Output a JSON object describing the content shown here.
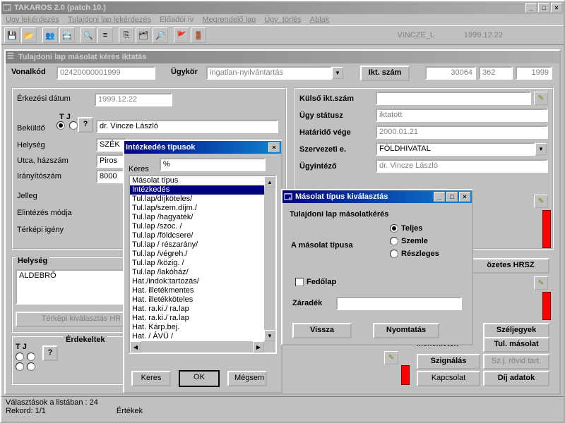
{
  "app": {
    "title": "TAKAROS 2.0 (patch 10.)",
    "user": "VINCZE_L",
    "date": "1999.12.22"
  },
  "menu": {
    "m1": "Ügy lekérdezés",
    "m2": "Tulajdoni lap lekérdezés",
    "m3": "Előadói ív",
    "m4": "Megrendelő lap",
    "m5": "Ügy_törlés",
    "m6": "Ablak"
  },
  "doc": {
    "title": "Tulajdoni lap másolat kérés iktatás",
    "vonalkod_lbl": "Vonalkód",
    "vonalkod": "02420000001999",
    "ugykor_lbl": "Ügykör",
    "ugykor": "ingatlan-nyilvántartás",
    "iktszam_lbl": "Ikt. szám",
    "ikt1": "30064",
    "ikt2": "362",
    "ikt3": "1999"
  },
  "left": {
    "erkezesi_lbl": "Érkezési dátum",
    "erkezesi": "1999.12.22",
    "tj_lbl": "T J",
    "q": "?",
    "bekuldo_lbl": "Beküldő",
    "bekuldo": "dr. Vincze László",
    "helyseg_lbl": "Helység",
    "helyseg": "SZÉK",
    "utca_lbl": "Utca, házszám",
    "utca": "Piros",
    "irsz_lbl": "Irányítószám",
    "irsz": "8000",
    "jelleg_lbl": "Jelleg",
    "elint_lbl": "Elintézés módja",
    "terkep_lbl": "Térképi igény",
    "helyseg2_lbl": "Helység",
    "helyseg2": "ALDEBRŐ",
    "terkepbtn": "Térképi kiválasztás HR",
    "erdekeltek": "Érdekeltek"
  },
  "right": {
    "kulso_lbl": "Külső ikt.szám",
    "status_lbl": "Ügy státusz",
    "status": "iktatott",
    "hatarido_lbl": "Határidő vége",
    "hatarido": "2000.01.21",
    "szerv_lbl": "Szervezeti e.",
    "szerv": "FÖLDHIVATAL",
    "ugyint_lbl": "Ügyintéző",
    "ugyint": "dr. Vincze László",
    "elozetes": "özetes HRSZ",
    "szel": "Széljegyek",
    "mellek": "Mellékletek",
    "tulmas": "Tul. másolat",
    "szign": "Szignálás",
    "szrov": "Sz.j. rövid tart.",
    "kapcs": "Kapcsolat",
    "dij": "Díj adatok"
  },
  "popup1": {
    "title": "Intézkedés típusok",
    "keres_lbl": "Keres",
    "keres": "%",
    "items": [
      "Másolat típus",
      "Intézkedés",
      "Tul.lap/díjköteles/",
      "Tul.lap/szem.díjm./",
      "Tul.lap /hagyaték/",
      "Tul.lap /szoc. /",
      "Tul.lap /földcsere/",
      "Tul.lap / részarány/",
      "Tul.lap /végreh./",
      "Tul.lap /közig. /",
      "Tul.lap /lakóház/",
      "Hat./indok:tartozás/",
      "Hat. illetékmentes",
      "Hat. illetékköteles",
      "Hat. ra.ki./ ra.lap",
      "Hat. ra.ki./ ra.lap",
      "Hat. Kárp.bej.",
      "Hat. / ÁVÜ /"
    ],
    "sel_index": 1,
    "btn_keres": "Keres",
    "btn_ok": "OK",
    "btn_megsem": "Mégsem"
  },
  "popup2": {
    "title": "Másolat  típus kiválasztás",
    "heading": "Tulajdoni lap másolatkérés",
    "tipus_lbl": "A másolat típusa",
    "r_teljes": "Teljes",
    "r_szemle": "Szemle",
    "r_reszl": "Részleges",
    "fedolap": "Fedőlap",
    "zaradek_lbl": "Záradék",
    "btn_vissza": "Vissza",
    "btn_nyomt": "Nyomtatás"
  },
  "status": {
    "s1": "Választások a listában : 24",
    "s2": "Rekord: 1/1",
    "s3": "Értékek"
  }
}
